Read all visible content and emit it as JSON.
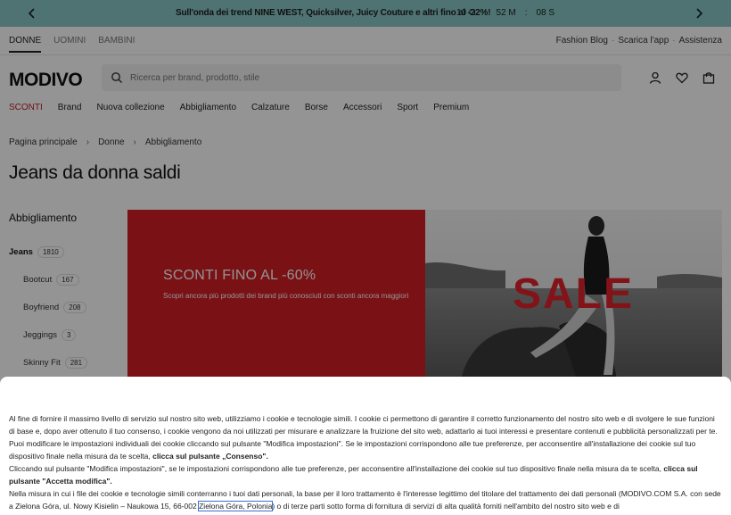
{
  "promo": {
    "message": "Sull'onda dei trend NINE WEST, Quicksilver, Juicy Couture e altri fino al -22%!",
    "timer": {
      "days": "10 O",
      "minutes": "52 M",
      "seconds": "08 S"
    },
    "bg_color": "#88c7c6"
  },
  "topnav": {
    "genders": [
      "DONNE",
      "UOMINI",
      "BAMBINI"
    ],
    "util": [
      "Fashion Blog",
      "Scarica l'app",
      "Assistenza"
    ]
  },
  "header": {
    "logo": "MODIVO",
    "search_placeholder": "Ricerca per brand, prodotto, stile"
  },
  "categories": [
    "SCONTI",
    "Brand",
    "Nuova collezione",
    "Abbigliamento",
    "Calzature",
    "Borse",
    "Accessori",
    "Sport",
    "Premium"
  ],
  "breadcrumb": [
    "Pagina principale",
    "Donne",
    "Abbigliamento"
  ],
  "page_title": "Jeans da donna saldi",
  "sidebar": {
    "heading": "Abbigliamento",
    "items": [
      {
        "label": "Jeans",
        "count": "1810"
      },
      {
        "label": "Bootcut",
        "count": "167"
      },
      {
        "label": "Boyfriend",
        "count": "208"
      },
      {
        "label": "Jeggings",
        "count": "3"
      },
      {
        "label": "Skinny Fit",
        "count": "281"
      }
    ]
  },
  "banner": {
    "heading": "SCONTI FINO AL -60%",
    "text": "Scopri ancora più prodotti dei brand più conosciuti con sconti ancora maggiori",
    "sale_word": "SALE",
    "red": "#d31e25"
  },
  "cookie": {
    "p1a": "Al fine di fornire il massimo livello di servizio sul nostro sito web, utilizziamo i cookie e tecnologie simili. I cookie ci permettono di garantire il corretto funzionamento del nostro sito web e di svolgere le sue funzioni di base e, dopo aver ottenuto il tuo consenso, i cookie vengono da noi utilizzati per misurare e analizzare la fruizione del sito web, adattarlo ai tuoi interessi e presentare contenuti e pubblicità personalizzati per te. Puoi modificare le impostazioni individuali dei cookie cliccando sul pulsante \"Modifica impostazioni\". Se le impostazioni corrispondono alle tue preferenze, per acconsentire all'installazione dei cookie sul tuo dispositivo finale nella misura da te scelta,",
    "p1b": "clicca sul pulsante „Consenso\".",
    "p2a": "Cliccando sul pulsante \"Modifica impostazioni\", se le impostazioni corrispondono alle tue preferenze, per acconsentire all'installazione dei cookie sul tuo dispositivo finale nella misura da te scelta,",
    "p2b": "clicca sul pulsante \"Accetta modifica\".",
    "p3a": "Nella misura in cui i file dei cookie e tecnologie simili conterranno i tuoi dati personali, la base per il loro trattamento è l'interesse legittimo del titolare del trattamento dei dati personali (MODIVO.COM S.A. con sede a Zielona Góra, ul. Nowy Kisielin – Naukowa 15, 66-002",
    "p3b": "Zielona Góra, Polonia",
    "p3c": ") o di terze parti sotto forma di fornitura di servizi di alta qualità forniti nell'ambito del nostro sito web e di"
  }
}
